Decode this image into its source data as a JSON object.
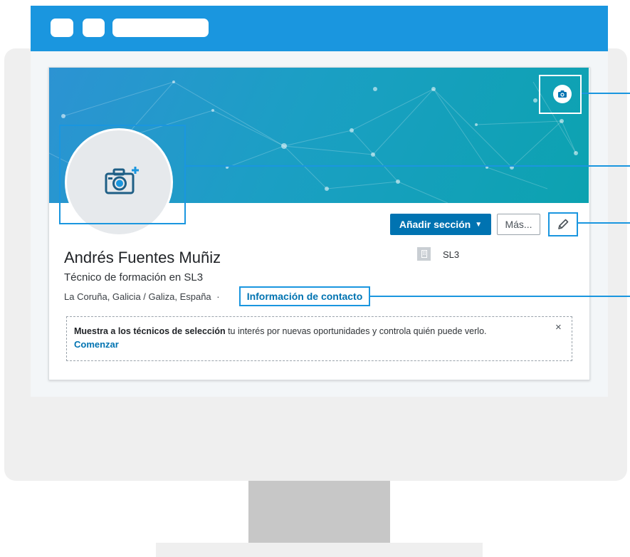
{
  "profile": {
    "name": "Andrés Fuentes Muñiz",
    "headline": "Técnico de formación en SL3",
    "location": "La Coruña, Galicia / Galiza, España",
    "separator": "·",
    "contact_link": "Información de contacto",
    "company": "SL3"
  },
  "actions": {
    "add_section": "Añadir sección",
    "add_section_caret": "▼",
    "more": "Más..."
  },
  "notice": {
    "bold_text": "Muestra a los técnicos de selección",
    "text": " tu interés por nuevas oportunidades y controla quién puede verlo.",
    "link": "Comenzar",
    "close": "×"
  },
  "icons": {
    "cover_photo": "camera-icon",
    "profile_photo": "camera-plus-icon",
    "edit": "pencil-icon",
    "company_logo": "building-icon",
    "close": "close-icon"
  },
  "colors": {
    "browser_bar": "#1a96df",
    "primary_button": "#0073b1",
    "link": "#0073b1",
    "highlight": "#1a96df",
    "cover_start": "#2c93d3",
    "cover_end": "#0ca2b0"
  }
}
